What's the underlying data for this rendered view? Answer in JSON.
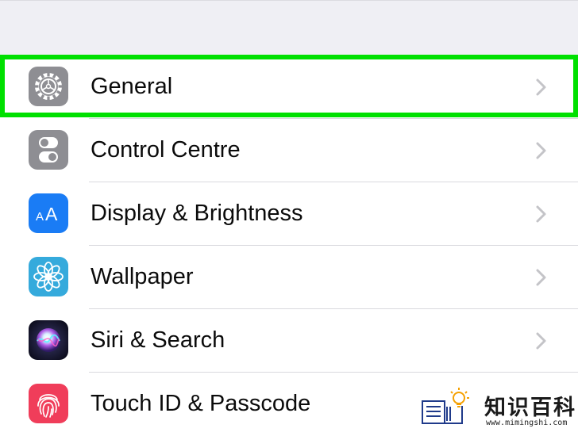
{
  "settings": {
    "items": [
      {
        "label": "General",
        "icon": "gear-icon",
        "icon_color": "#8e8e93",
        "highlighted": true
      },
      {
        "label": "Control Centre",
        "icon": "toggle-switches-icon",
        "icon_color": "#8e8e93",
        "highlighted": false
      },
      {
        "label": "Display & Brightness",
        "icon": "text-size-aa-icon",
        "icon_color": "#1a7cf5",
        "highlighted": false
      },
      {
        "label": "Wallpaper",
        "icon": "flower-icon",
        "icon_color": "#35aadc",
        "highlighted": false
      },
      {
        "label": "Siri & Search",
        "icon": "siri-icon",
        "icon_color": "#1b1b3a",
        "highlighted": false
      },
      {
        "label": "Touch ID & Passcode",
        "icon": "fingerprint-icon",
        "icon_color": "#f03d5a",
        "highlighted": false
      }
    ]
  },
  "highlight_color": "#00e000",
  "watermark": {
    "title": "知识百科",
    "url": "www.mimingshi.com"
  }
}
